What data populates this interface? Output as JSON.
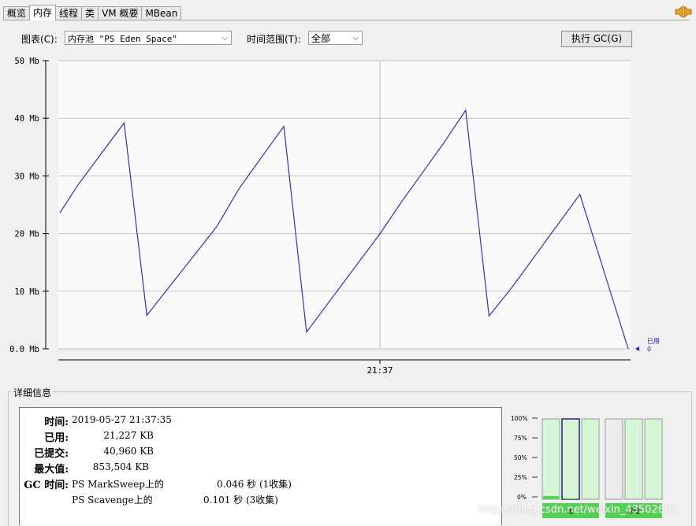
{
  "tabs": [
    "概览",
    "内存",
    "线程",
    "类",
    "VM 概要",
    "MBean"
  ],
  "active_tab": 1,
  "controls": {
    "chart_label": "图表(C):",
    "chart_value": "内存池 \"PS Eden Space\"",
    "range_label": "时间范围(T):",
    "range_value": "全部",
    "gc_button": "执行 GC(G)"
  },
  "chart_data": {
    "type": "line",
    "y_ticks": [
      "0.0 Mb",
      "10 Mb",
      "20 Mb",
      "30 Mb",
      "40 Mb",
      "50 Mb"
    ],
    "ylim": [
      0,
      50
    ],
    "x_tick": "21:37",
    "series": [
      {
        "name": "已用",
        "values": [
          23.6,
          28.6,
          39.2,
          5.8,
          21.2,
          27.9,
          38.6,
          2.9,
          13.6,
          19.8,
          25.2,
          30.3,
          35.8,
          41.4,
          5.7,
          10.6,
          26.8,
          0.0
        ]
      }
    ],
    "x": [
      0,
      0.033,
      0.113,
      0.153,
      0.276,
      0.316,
      0.394,
      0.434,
      0.515,
      0.562,
      0.599,
      0.636,
      0.676,
      0.714,
      0.755,
      0.795,
      0.915,
      1.0
    ],
    "legend_label": "已用",
    "legend_value": "0",
    "line_color": "#3030c0"
  },
  "details": {
    "title": "详细信息",
    "rows": [
      {
        "label": "时间:",
        "value": "2019-05-27 21:37:35"
      },
      {
        "label": "已用:",
        "value": "21,227 KB"
      },
      {
        "label": "已提交:",
        "value": "40,960 KB"
      },
      {
        "label": "最大值:",
        "value": "853,504 KB"
      }
    ],
    "gc_label": "GC 时间:",
    "gc_rows": [
      {
        "name": "PS MarkSweep上的",
        "value": "0.046 秒 (1收集)"
      },
      {
        "name": "PS Scavenge上的",
        "value": "0.101 秒 (3收集)"
      }
    ]
  },
  "pool_bars": {
    "ticks": [
      "100%",
      "75%",
      "50%",
      "25%",
      "0%"
    ],
    "heap_label": "堆",
    "nonheap_label": "非堆",
    "heap_fill": [
      0.04,
      0.01,
      0.0
    ],
    "nonheap_fill": [
      0.0,
      0.0,
      0.0
    ],
    "selected_index": 1
  },
  "watermark": "https://blog.csdn.net/weixin_43502661"
}
